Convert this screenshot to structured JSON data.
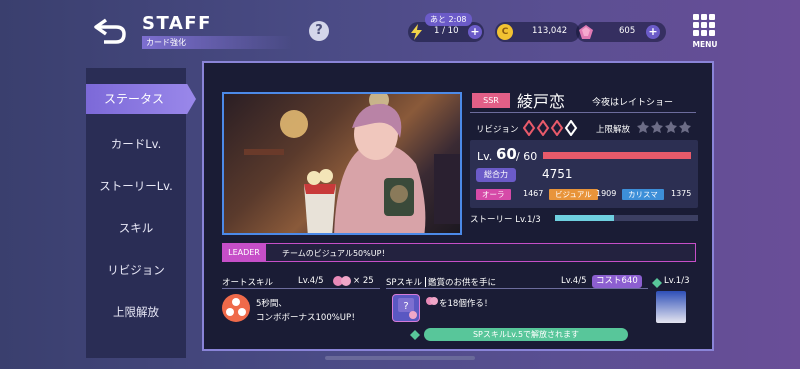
{
  "header": {
    "title": "STAFF",
    "subtitle": "カード強化",
    "help_glyph": "?",
    "menu_label": "MENU"
  },
  "resources": {
    "stamina_timer": "あと 2:08",
    "stamina": "1 / 10",
    "coins": "113,042",
    "gems": "605",
    "plus_glyph": "+",
    "coin_glyph": "C"
  },
  "sidebar": {
    "items": [
      "ステータス",
      "カードLv.",
      "ストーリーLv.",
      "スキル",
      "リビジョン",
      "上限解放"
    ]
  },
  "card": {
    "rarity": "SSR",
    "name": "綾戸恋",
    "title": "今夜はレイトショー",
    "revision_label": "リビジョン",
    "limit_break_label": "上限解放",
    "revision_filled": 3,
    "revision_total": 4,
    "limit_break_filled": 0,
    "limit_break_total": 4,
    "level_label": "Lv.",
    "level": "60",
    "level_max": "/ 60",
    "level_fill": 1.0,
    "power_label": "総合力",
    "power": "4751",
    "attributes": [
      {
        "name": "オーラ",
        "value": "1467",
        "color": "#d64aa8"
      },
      {
        "name": "ビジュアル",
        "value": "1909",
        "color": "#e8943a"
      },
      {
        "name": "カリスマ",
        "value": "1375",
        "color": "#3d8fd8"
      }
    ],
    "story_label": "ストーリー Lv.1/3",
    "story_fill": 0.41
  },
  "leader": {
    "tag": "LEADER",
    "text": "チームのビジュアル50%UP！"
  },
  "auto_skill": {
    "label": "オートスキル",
    "level": "Lv.4/5",
    "count": "× 25",
    "desc1": "5秒間、",
    "desc2": "コンボボーナス100%UP！"
  },
  "sp_skill": {
    "label": "SPスキル",
    "name": "鑑賞のお供を手に",
    "level": "Lv.4/5",
    "cost": "コスト640",
    "desc": "を18個作る！",
    "unlock": "SPスキルLv.5で解放されます"
  },
  "partner": {
    "level": "Lv.1/3"
  },
  "colors": {
    "accent": "#7c69d8",
    "rarity": "#e25f87",
    "leader": "#c64fc8",
    "level_bar": "#e85a6a",
    "story_bar": "#6fd0e0",
    "sp_unlock": "#58c69a"
  }
}
